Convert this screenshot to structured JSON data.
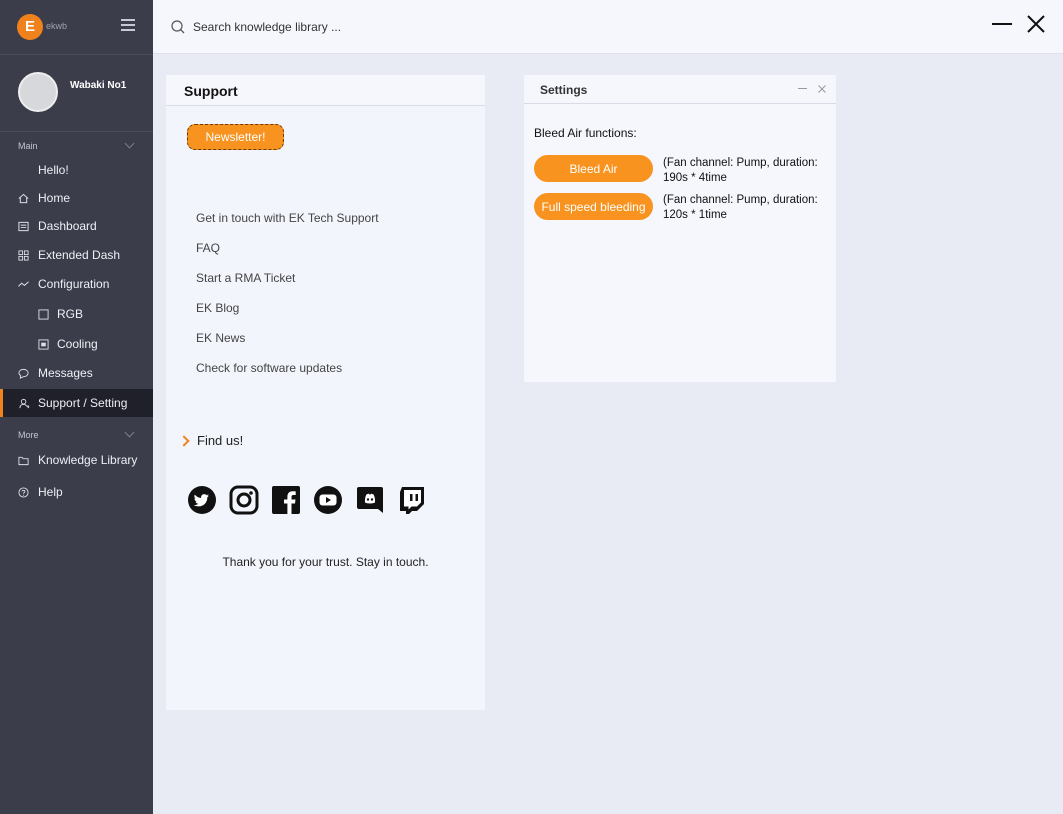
{
  "app": {
    "logo_letter": "E",
    "logo_text": "ekwb"
  },
  "user": {
    "name": "Wabaki No1"
  },
  "sidebar": {
    "main_label": "Main",
    "more_label": "More",
    "items": [
      {
        "label": "Hello!"
      },
      {
        "label": "Home"
      },
      {
        "label": "Dashboard"
      },
      {
        "label": "Extended Dash"
      },
      {
        "label": "Configuration"
      },
      {
        "label": "RGB"
      },
      {
        "label": "Cooling"
      },
      {
        "label": "Messages"
      },
      {
        "label": "Support / Setting"
      },
      {
        "label": "Knowledge Library"
      },
      {
        "label": "Help"
      }
    ],
    "active_item": "Support / Setting"
  },
  "search": {
    "placeholder": "Search knowledge library ..."
  },
  "support": {
    "title": "Support",
    "newsletter_label": "Newsletter!",
    "links": [
      "Get in touch with EK Tech Support",
      "FAQ",
      "Start a RMA Ticket",
      "EK Blog",
      "EK News",
      "Check for software updates"
    ],
    "find_us": "Find us!",
    "social": [
      "twitter-icon",
      "instagram-icon",
      "facebook-icon",
      "youtube-icon",
      "discord-icon",
      "twitch-icon"
    ],
    "thanks": "Thank you for your trust. Stay in touch."
  },
  "settings": {
    "title": "Settings",
    "bleed_label": "Bleed Air functions:",
    "bleed_air_label": "Bleed Air",
    "bleed_air_desc": "(Fan channel: Pump, duration: 190s * 4time",
    "full_speed_label": "Full speed bleeding",
    "full_speed_desc": "(Fan channel: Pump, duration: 120s * 1time"
  },
  "colors": {
    "accent": "#f7931e",
    "sidebar_bg": "#3b3d4b",
    "content_bg": "#e8ebf4"
  }
}
